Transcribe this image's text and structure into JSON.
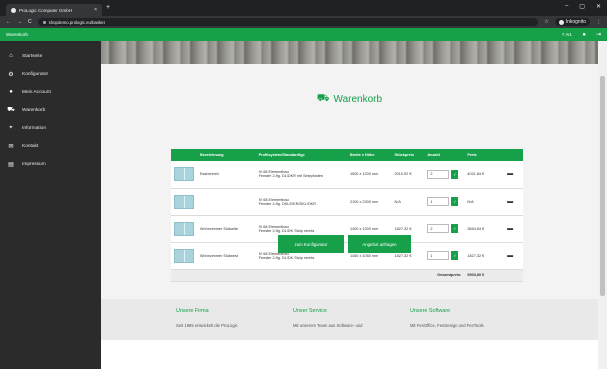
{
  "browser": {
    "tab_title": "ProLogic Computer GmbH",
    "tab_close": "×",
    "new_tab": "+",
    "url": "shopdemo.prologic.eu/basket",
    "profile_label": "Inkognito",
    "win_min": "–",
    "win_max": "▢",
    "win_close": "✕"
  },
  "appbar": {
    "title": "Warenkorb",
    "cart_count": "7 Art.",
    "user_icon": "user-icon",
    "door_icon": "logout-icon"
  },
  "sidebar": {
    "items": [
      {
        "label": "Startseite",
        "icon": "home-icon",
        "glyph": "⌂"
      },
      {
        "label": "Konfigurator",
        "icon": "gear-icon",
        "glyph": "⚙"
      },
      {
        "label": "Mein Account",
        "icon": "user-icon",
        "glyph": "●"
      },
      {
        "label": "Warenkorb",
        "icon": "cart-icon",
        "glyph": "⛟"
      },
      {
        "label": "Information",
        "icon": "marker-icon",
        "glyph": "⌖"
      },
      {
        "label": "Kontakt",
        "icon": "mail-icon",
        "glyph": "✉"
      },
      {
        "label": "Impressum",
        "icon": "doc-icon",
        "glyph": "▤"
      }
    ]
  },
  "cart": {
    "title": "Warenkorb",
    "columns": [
      "Bezeichnung",
      "Profilsystem/Standardtyp",
      "Breite x Höhe",
      "Stückpreis",
      "Anzahl",
      "Preis"
    ],
    "rows": [
      {
        "name": "Essbereich",
        "profile_line1": "IV 68 Elementbau",
        "profile_line2": "Fenster 2-flg. DL/DKR mit Setzpfosten",
        "size": "1500 x 1200 mm",
        "unit_price": "2010,92 €",
        "qty": "2",
        "price": "4021,84 €"
      },
      {
        "name": "",
        "profile_line1": "IV 68 Elementbau",
        "profile_line2": "Fenster 4-flg. DKL/DKR/DKL/DKR",
        "size": "2100 x 2300 mm",
        "unit_price": "N/A",
        "qty": "1",
        "price": "N/A"
      },
      {
        "name": "Wohnzimmer Südseite",
        "profile_line1": "IV 68 Elementbau",
        "profile_line2": "Fenster 2-flg. DL/DK Stulp rechts",
        "size": "1400 x 1200 mm",
        "unit_price": "1827,32 €",
        "qty": "2",
        "price": "3654,64 €"
      },
      {
        "name": "Wohnzimmer Südwest",
        "profile_line1": "IV 68 Elementbau",
        "profile_line2": "Fenster 2-flg. DL/DK Stulp rechts",
        "size": "1450 x 1050 mm",
        "unit_price": "1827,32 €",
        "qty": "1",
        "price": "1827,32 €"
      }
    ],
    "total_label": "Gesamtpreis:",
    "total_value": "9503,80 €",
    "btn_ok": "✓",
    "btn_configurator": "zum Konfigurator",
    "btn_offer": "Angebot anfragen"
  },
  "footer": {
    "col1_title": "Unsere Firma",
    "col1_text": "Seit 1985 entwickelt die ProLogic",
    "col2_title": "Unser Service",
    "col2_text": "Mit unserem Team aus Software- und",
    "col3_title": "Unsere Software",
    "col3_text": "Mit FenOffice, FenDesign und FenTools"
  }
}
